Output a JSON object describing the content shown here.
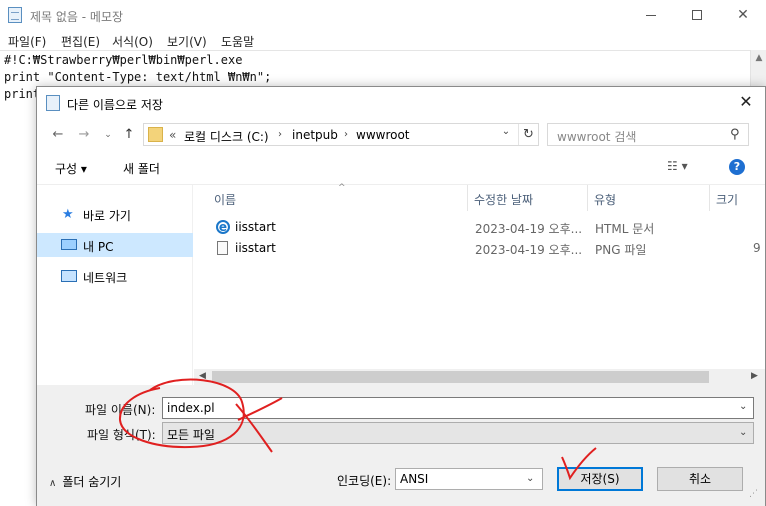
{
  "notepad": {
    "title": "제목 없음 - 메모장",
    "menu": [
      "파일(F)",
      "편집(E)",
      "서식(O)",
      "보기(V)",
      "도움말"
    ],
    "lines": [
      "#!C:₩Strawberry₩perl₩bin₩perl.exe",
      "print \"Content-Type: text/html ₩n₩n\";",
      "print"
    ]
  },
  "dialog": {
    "title": "다른 이름으로 저장",
    "breadcrumb": {
      "overflow": "«",
      "items": [
        "로컬 디스크 (C:)",
        "inetpub",
        "wwwroot"
      ]
    },
    "search_placeholder": "wwwroot 검색",
    "toolbar": {
      "organize": "구성 ▾",
      "new_folder": "새 폴더"
    },
    "nav": [
      {
        "label": "바로 가기",
        "icon": "star-icon"
      },
      {
        "label": "내 PC",
        "icon": "computer-icon",
        "selected": true
      },
      {
        "label": "네트워크",
        "icon": "network-icon"
      }
    ],
    "columns": [
      "이름",
      "수정한 날짜",
      "유형",
      "크기"
    ],
    "files": [
      {
        "name": "iisstart",
        "date": "2023-04-19 오후...",
        "type": "HTML 문서",
        "size": "",
        "icon": "ie-html-icon"
      },
      {
        "name": "iisstart",
        "date": "2023-04-19 오후...",
        "type": "PNG 파일",
        "size": "9",
        "icon": "png-file-icon"
      }
    ],
    "filename_label": "파일 이름(N):",
    "filename_value": "index.pl",
    "filetype_label": "파일 형식(T):",
    "filetype_value": "모든 파일",
    "hide_folders": "폴더 숨기기",
    "encoding_label": "인코딩(E):",
    "encoding_value": "ANSI",
    "save_button": "저장(S)",
    "cancel_button": "취소"
  },
  "colors": {
    "selection": "#cde8ff",
    "accent": "#0078d7",
    "annotation": "#e02020"
  }
}
